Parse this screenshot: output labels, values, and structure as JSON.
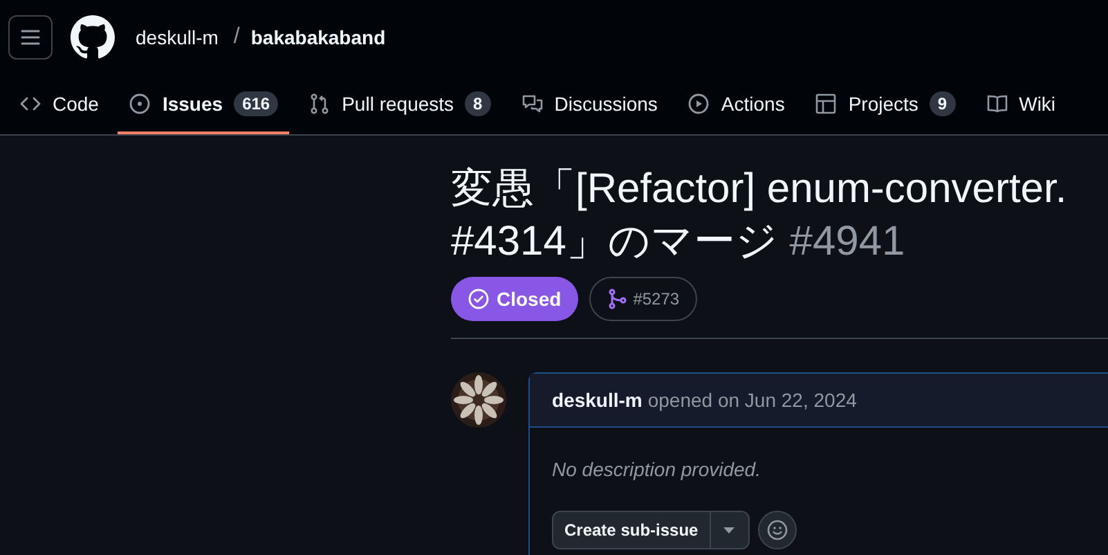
{
  "header": {
    "owner": "deskull-m",
    "separator": "/",
    "repo": "bakabakaband"
  },
  "tabs": [
    {
      "label": "Code",
      "kind": "code",
      "selected": false
    },
    {
      "label": "Issues",
      "kind": "issues",
      "count": "616",
      "selected": true
    },
    {
      "label": "Pull requests",
      "kind": "pulls",
      "count": "8",
      "selected": false
    },
    {
      "label": "Discussions",
      "kind": "discussions",
      "selected": false
    },
    {
      "label": "Actions",
      "kind": "actions",
      "selected": false
    },
    {
      "label": "Projects",
      "kind": "projects",
      "count": "9",
      "selected": false
    },
    {
      "label": "Wiki",
      "kind": "wiki",
      "selected": false
    }
  ],
  "issue": {
    "title_lines": [
      "変愚「[Refactor] enum-converter.",
      "#4314」のマージ"
    ],
    "number": "#4941",
    "closed": true,
    "state_label": "Closed",
    "linked_pr": "#5273"
  },
  "comment": {
    "author": "deskull-m",
    "meta": "opened on Jun 22, 2024",
    "body": "No description provided.",
    "sub_issue_button": "Create sub-issue"
  }
}
